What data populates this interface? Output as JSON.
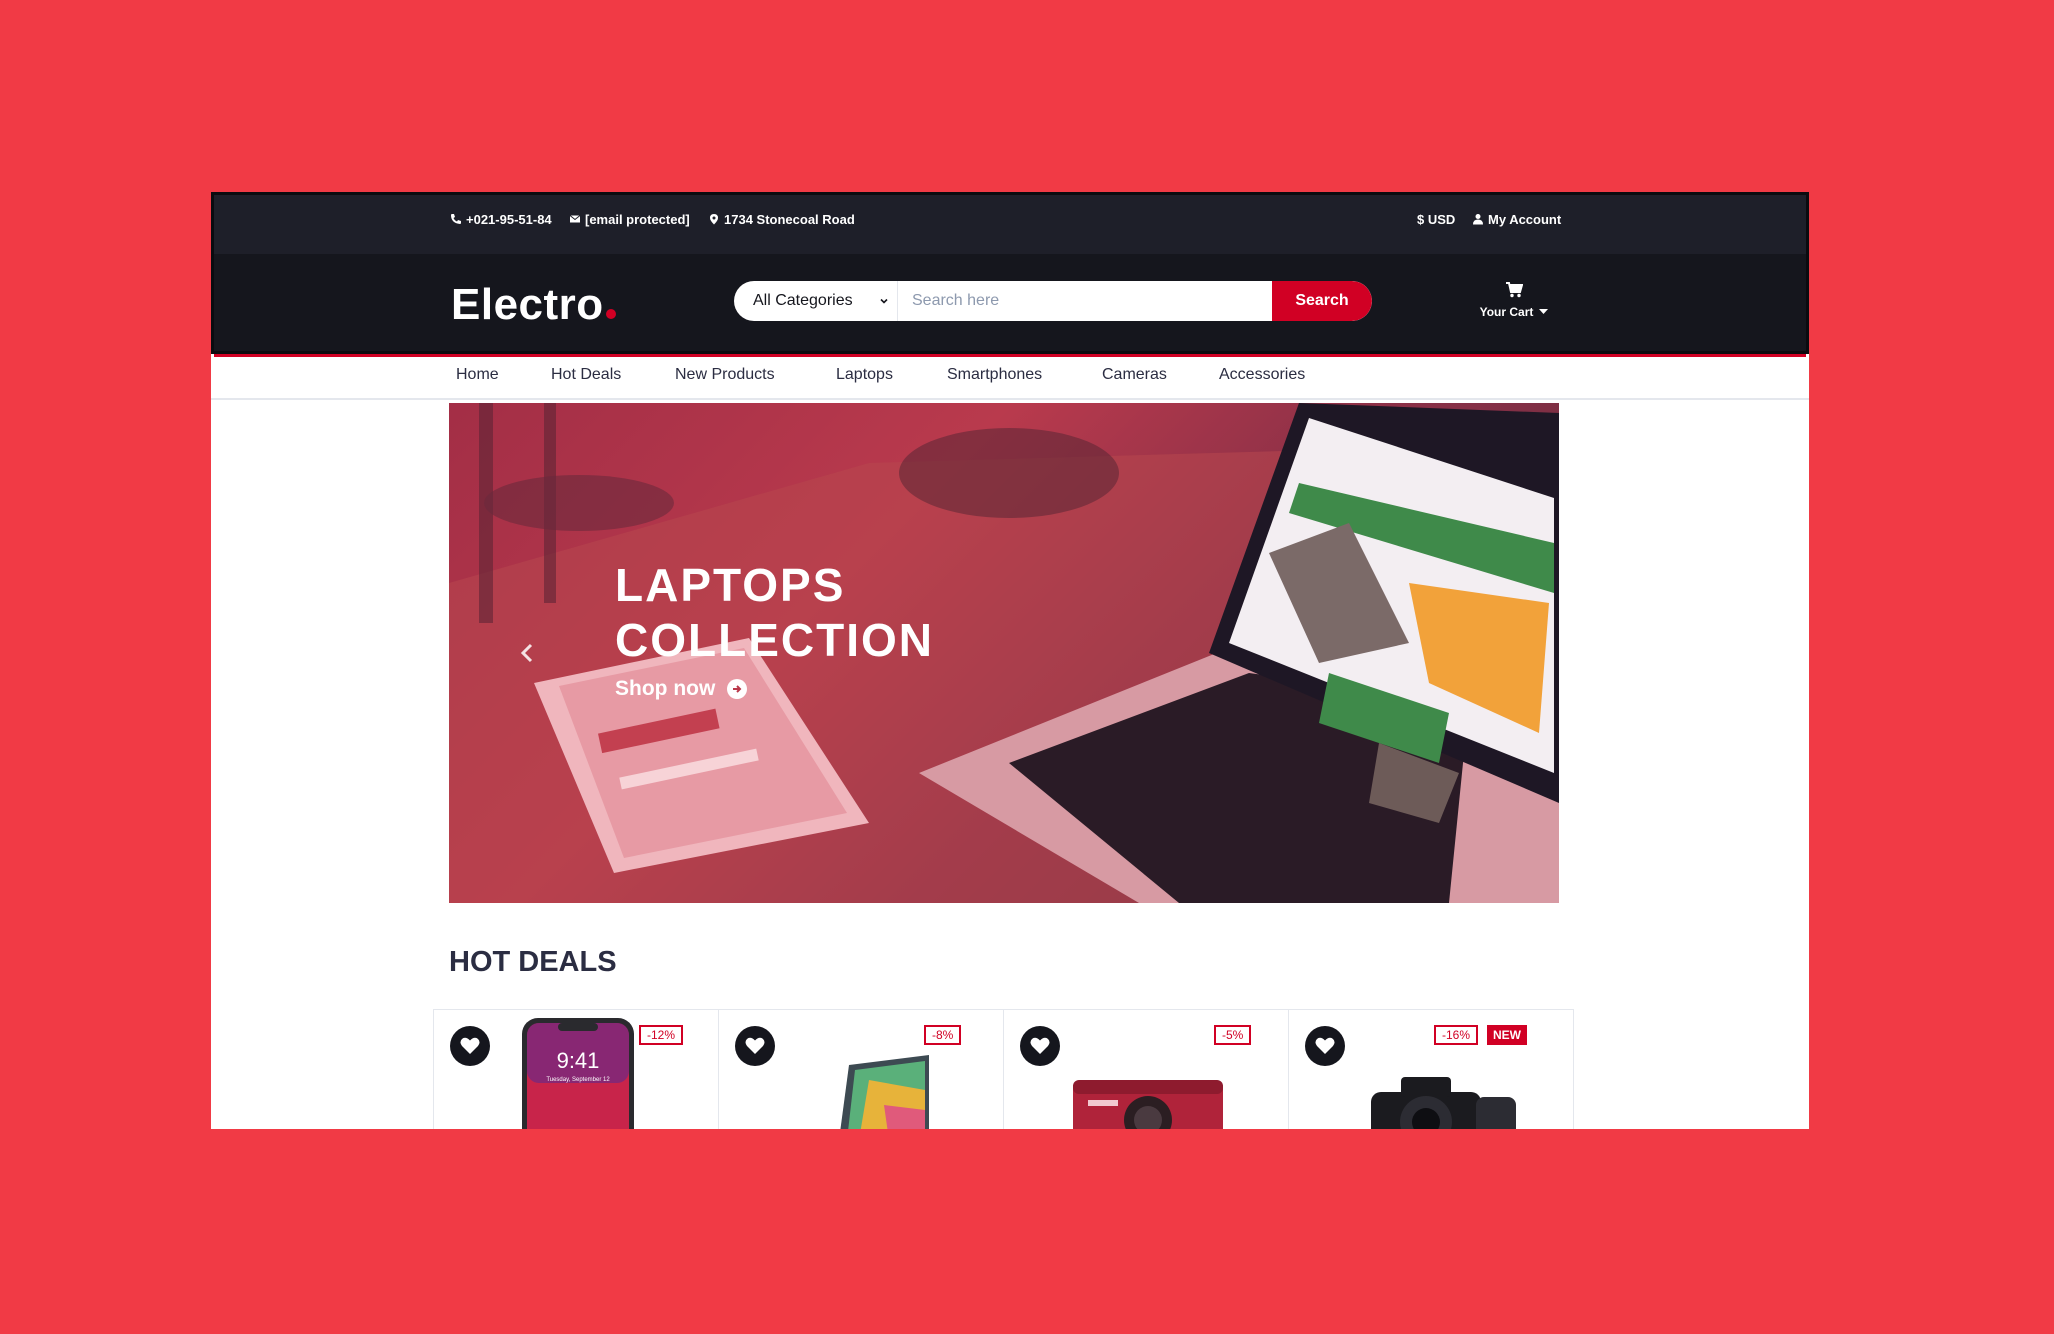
{
  "topbar": {
    "phone": "+021-95-51-84",
    "email": "[email protected]",
    "address": "1734 Stonecoal Road",
    "currency": "$ USD",
    "account": "My Account"
  },
  "header": {
    "logo": "Electro",
    "category_selected": "All Categories",
    "search_placeholder": "Search here",
    "search_button": "Search",
    "cart_label": "Your Cart"
  },
  "nav": {
    "items": [
      "Home",
      "Hot Deals",
      "New Products",
      "Laptops",
      "Smartphones",
      "Cameras",
      "Accessories"
    ]
  },
  "hero": {
    "title_line1": "LAPTOPS",
    "title_line2": "COLLECTION",
    "cta": "Shop now"
  },
  "hot_deals": {
    "title": "HOT DEALS",
    "products": [
      {
        "discount": "-12%",
        "badge": "",
        "image": "smartphone"
      },
      {
        "discount": "-8%",
        "badge": "",
        "image": "laptop"
      },
      {
        "discount": "-5%",
        "badge": "",
        "image": "compact-camera"
      },
      {
        "discount": "-16%",
        "badge": "NEW",
        "image": "dslr-camera"
      }
    ],
    "phone_screen_time": "9:41",
    "phone_screen_date": "Tuesday, September 12"
  },
  "colors": {
    "background": "#f13a45",
    "dark": "#15161d",
    "accent": "#d10024"
  }
}
